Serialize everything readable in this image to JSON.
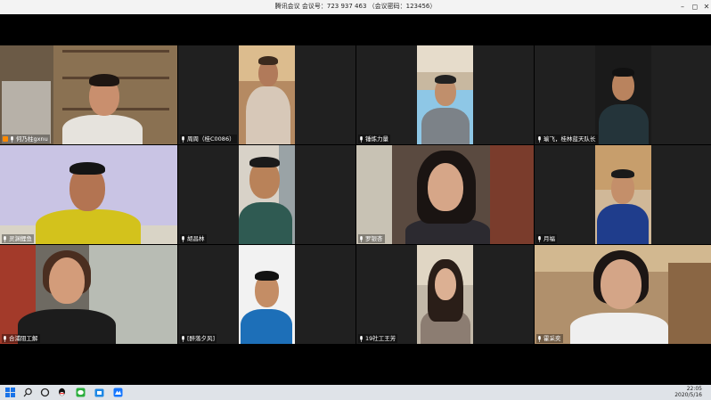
{
  "window": {
    "title": "腾讯会议 会议号：723 937 463 （会议密码：123456）",
    "minimize_icon": "minimize-icon",
    "maximize_icon": "maximize-icon",
    "close_icon": "close-icon"
  },
  "participants": [
    {
      "name": "何乃柱gxnu",
      "host": true,
      "speaking": true
    },
    {
      "name": "周周（桂C0086）",
      "host": false
    },
    {
      "name": "锤炼力量",
      "host": false
    },
    {
      "name": "瑜飞，桂林蓝天队长",
      "host": false
    },
    {
      "name": "灵渊鲤鱼",
      "host": false
    },
    {
      "name": "胡昌林",
      "host": false
    },
    {
      "name": "罗银杏",
      "host": false
    },
    {
      "name": "月福",
      "host": false
    },
    {
      "name": "合浦阻工解",
      "host": false
    },
    {
      "name": "[醉落夕风]",
      "host": false
    },
    {
      "name": "19社工王芳",
      "host": false
    },
    {
      "name": "霍采奕",
      "host": false
    }
  ],
  "taskbar": {
    "icons": [
      "windows-start-icon",
      "search-icon",
      "task-view-icon",
      "qq-icon",
      "wechat-icon",
      "store-icon",
      "meeting-icon"
    ],
    "time": "22:05",
    "date": "2020/5/16"
  },
  "colors": {
    "titlebar": "#f3f3f3",
    "active_border": "#2bb24c",
    "taskbar": "#dfe3e8",
    "host_badge": "#ff8a00"
  }
}
